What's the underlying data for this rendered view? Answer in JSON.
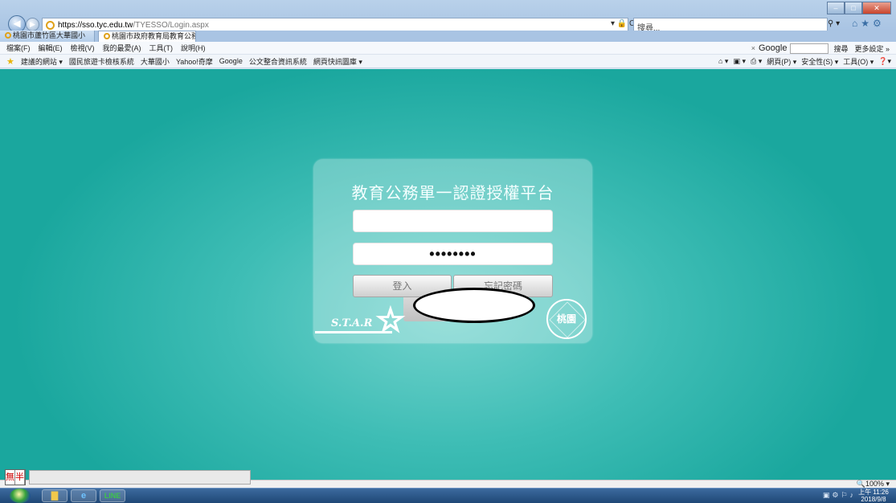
{
  "browser": {
    "address_host": "https://sso.tyc.edu.tw",
    "address_path": "/TYESSO/Login.aspx",
    "addr_tools": "▾ 🔒 C",
    "search_placeholder": "搜尋...",
    "tabs": [
      {
        "label": "桃園市蘆竹區大華國小"
      },
      {
        "label": "桃園市政府教育局教育公務..."
      }
    ],
    "menu": [
      "檔案(F)",
      "編輯(E)",
      "檢視(V)",
      "我的最愛(A)",
      "工具(T)",
      "說明(H)"
    ],
    "google_bar": {
      "close": "×",
      "logo": "Google",
      "search": "搜尋",
      "more": "更多設定 »"
    },
    "favorites": [
      "建議的網站 ▾",
      "國民旅遊卡檢核系統",
      "大華國小",
      "Yahoo!奇摩",
      "Google",
      "公文整合資訊系統",
      "網頁快訊圖庫 ▾"
    ],
    "commands": [
      "網頁(P) ▾",
      "安全性(S) ▾",
      "工具(O) ▾"
    ]
  },
  "login": {
    "title": "教育公務單一認證授權平台",
    "username_value": "",
    "password_value": "••••••••",
    "login_button": "登入",
    "forgot_button": "忘記密碼",
    "logo_text": "S.T.A.R",
    "seal_text": "桃園"
  },
  "status": {
    "ime_chars": [
      "無",
      "半"
    ],
    "zoom": "🔍100% ▾"
  },
  "taskbar": {
    "clock_time": "上午 11:26",
    "clock_date": "2018/9/8"
  }
}
